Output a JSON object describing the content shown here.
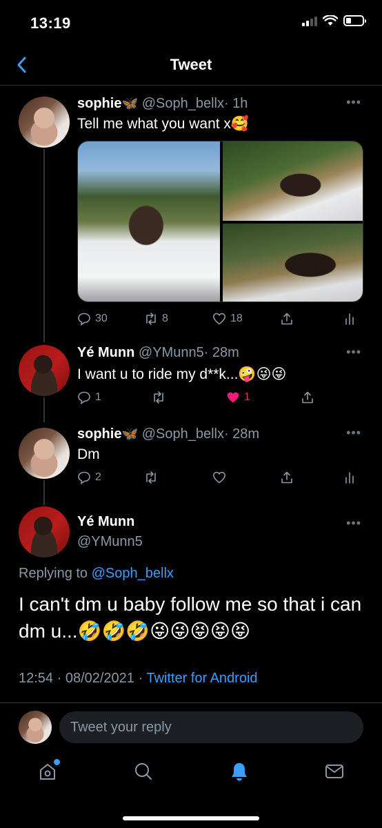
{
  "status_bar": {
    "time": "13:19"
  },
  "header": {
    "title": "Tweet"
  },
  "tweets": [
    {
      "name": "sophie",
      "badge": "🦋",
      "handle": "@Soph_bellx",
      "time": "· 1h",
      "text": "Tell me what you want x🥰",
      "replies": "30",
      "retweets": "8",
      "likes": "18"
    },
    {
      "name": "Yé Munn",
      "handle": "@YMunn5",
      "time": "· 28m",
      "text": "I want u to ride my d**k...🤪😜😜",
      "replies": "1",
      "likes": "1",
      "liked": true
    },
    {
      "name": "sophie",
      "badge": "🦋",
      "handle": "@Soph_bellx",
      "time": "· 28m",
      "text": "Dm",
      "replies": "2"
    }
  ],
  "main_tweet": {
    "name": "Yé Munn",
    "handle": "@YMunn5",
    "replying_label": "Replying to",
    "replying_to": "@Soph_bellx",
    "text": "I can't dm u baby follow me so that i can dm u...🤣🤣🤣😜😜😝😝😝",
    "timestamp": "12:54 · 08/02/2021 ·",
    "source": "Twitter for Android"
  },
  "reply_bar": {
    "placeholder": "Tweet your reply"
  },
  "tab_bar": {
    "items": [
      "home-icon",
      "search-icon",
      "notifications-icon",
      "messages-icon"
    ]
  },
  "colors": {
    "accent": "#3aa0ff",
    "like": "#f91880",
    "background": "#000000"
  }
}
